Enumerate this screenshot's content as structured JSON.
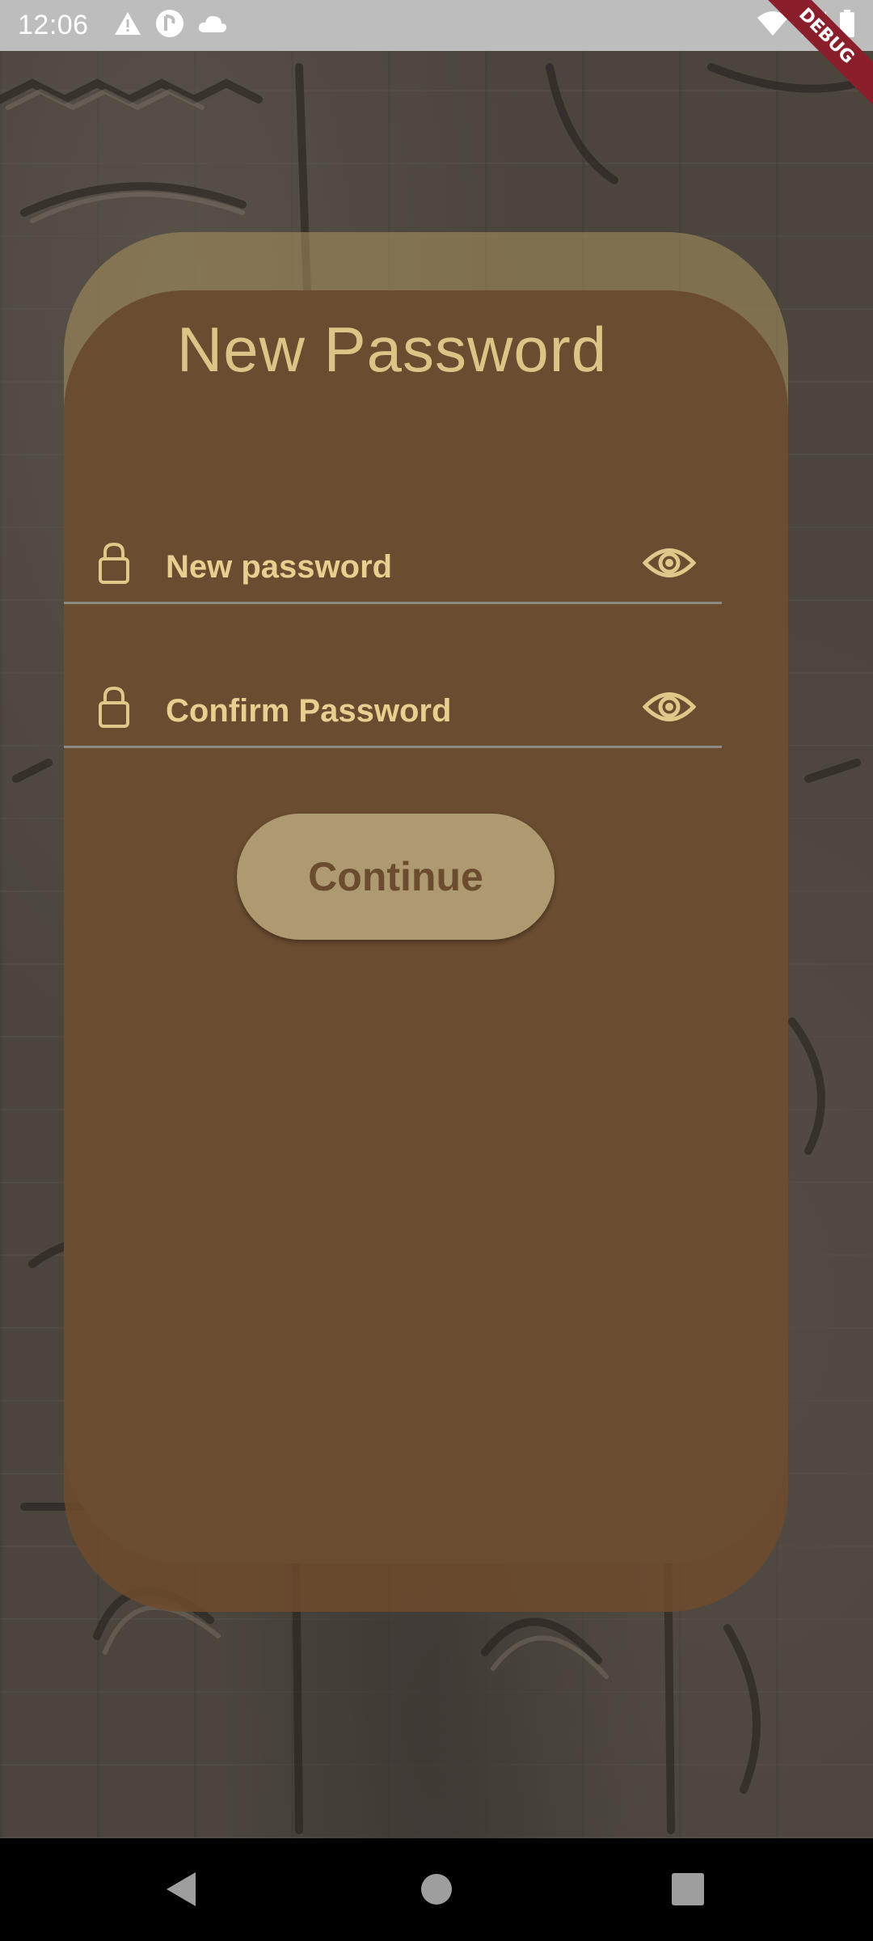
{
  "status_bar": {
    "time": "12:06",
    "icons": [
      "warning-icon",
      "app-icon",
      "cloud-icon",
      "wifi-icon",
      "signal-icon",
      "battery-icon"
    ]
  },
  "debug_banner": "DEBUG",
  "card": {
    "title": "New Password"
  },
  "fields": {
    "new_password": {
      "placeholder": "New password",
      "icon": "lock-icon",
      "toggle_icon": "eye-icon"
    },
    "confirm_password": {
      "placeholder": "Confirm Password",
      "icon": "lock-icon",
      "toggle_icon": "eye-icon"
    }
  },
  "continue_button": {
    "label": "Continue"
  },
  "nav_bar": {
    "icons": [
      "back-icon",
      "home-icon",
      "recents-icon"
    ]
  },
  "colors": {
    "accent_text": "#dcc486",
    "card": "#6a4c30",
    "button": "#ae9a70",
    "button_text": "#6b4c2e"
  }
}
